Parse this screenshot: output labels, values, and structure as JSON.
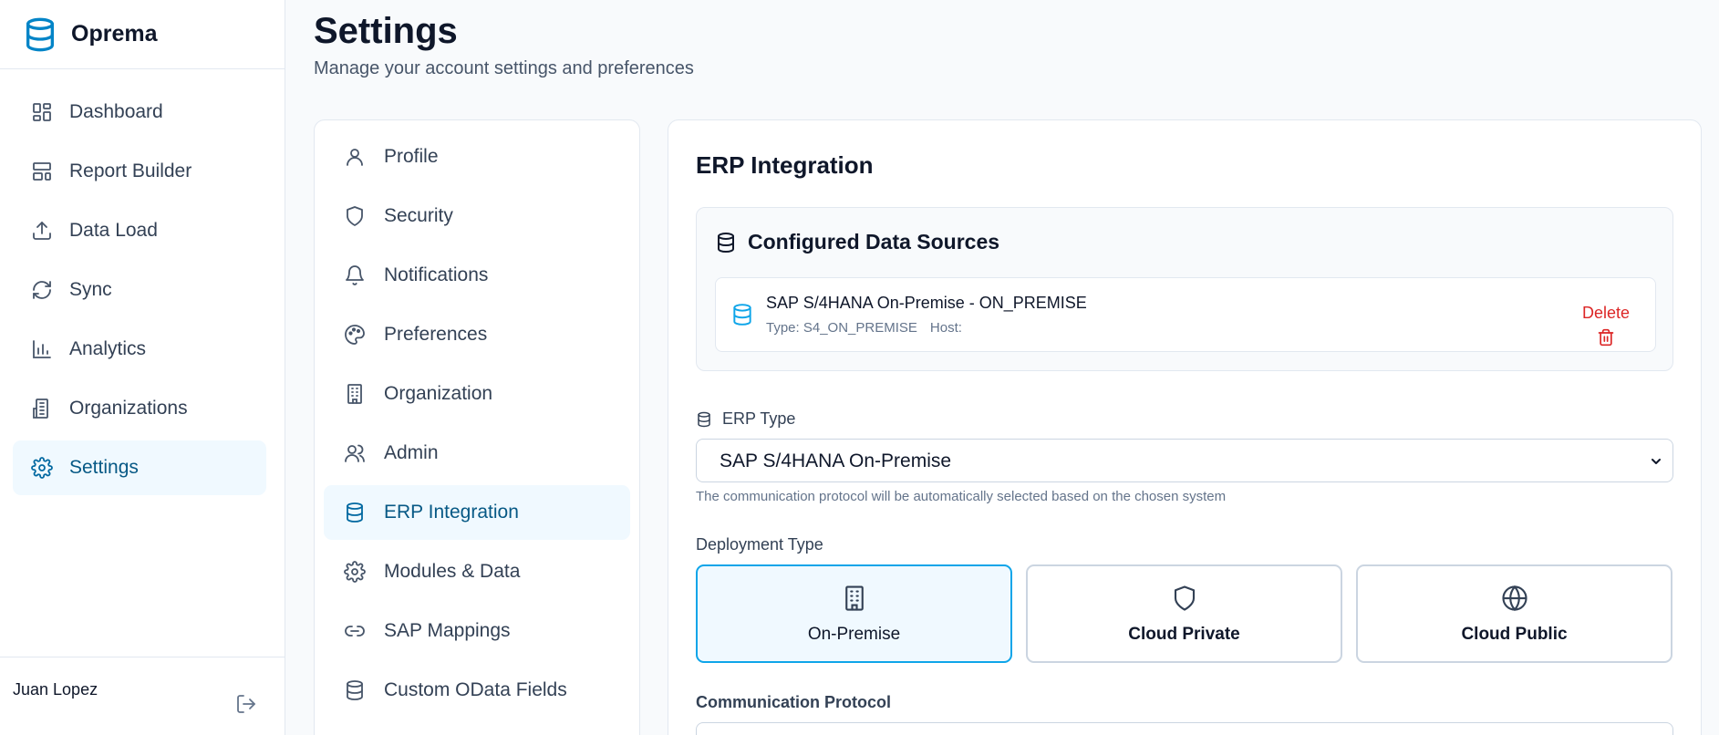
{
  "app": {
    "name": "Oprema",
    "logo_icon": "database-icon",
    "accent": "#0284c7"
  },
  "sidebar": {
    "items": [
      {
        "label": "Dashboard",
        "icon": "dashboard-icon"
      },
      {
        "label": "Report Builder",
        "icon": "layout-icon"
      },
      {
        "label": "Data Load",
        "icon": "upload-icon"
      },
      {
        "label": "Sync",
        "icon": "refresh-icon"
      },
      {
        "label": "Analytics",
        "icon": "bar-chart-icon"
      },
      {
        "label": "Organizations",
        "icon": "building-icon"
      },
      {
        "label": "Settings",
        "icon": "gear-icon",
        "active": true
      }
    ],
    "user": {
      "name": "Juan Lopez",
      "logout_icon": "logout-icon"
    }
  },
  "header": {
    "title": "Settings",
    "subtitle": "Manage your account settings and preferences"
  },
  "settings_menu": {
    "items": [
      {
        "label": "Profile",
        "icon": "user-icon"
      },
      {
        "label": "Security",
        "icon": "shield-icon"
      },
      {
        "label": "Notifications",
        "icon": "bell-icon"
      },
      {
        "label": "Preferences",
        "icon": "palette-icon"
      },
      {
        "label": "Organization",
        "icon": "building-icon"
      },
      {
        "label": "Admin",
        "icon": "users-icon"
      },
      {
        "label": "ERP Integration",
        "icon": "database-icon",
        "active": true
      },
      {
        "label": "Modules & Data",
        "icon": "gear-icon"
      },
      {
        "label": "SAP Mappings",
        "icon": "link-icon"
      },
      {
        "label": "Custom OData Fields",
        "icon": "database-icon"
      }
    ]
  },
  "panel": {
    "title": "ERP Integration",
    "data_sources": {
      "title": "Configured Data Sources",
      "items": [
        {
          "name": "SAP S/4HANA On-Premise - ON_PREMISE",
          "type_label": "Type: S4_ON_PREMISE",
          "host_label": "Host:",
          "delete_label": "Delete"
        }
      ]
    },
    "erp_type": {
      "label": "ERP Type",
      "selected": "SAP S/4HANA On-Premise",
      "hint": "The communication protocol will be automatically selected based on the chosen system"
    },
    "deployment": {
      "label": "Deployment Type",
      "options": [
        {
          "label": "On-Premise",
          "icon": "building-icon",
          "selected": true
        },
        {
          "label": "Cloud Private",
          "icon": "shield-icon",
          "selected": false
        },
        {
          "label": "Cloud Public",
          "icon": "globe-icon",
          "selected": false
        }
      ]
    },
    "protocol": {
      "label": "Communication Protocol"
    }
  },
  "colors": {
    "active_bg": "#f0f9ff",
    "active_text": "#075985",
    "selected_border": "#0ea5e9",
    "danger": "#dc2626"
  }
}
